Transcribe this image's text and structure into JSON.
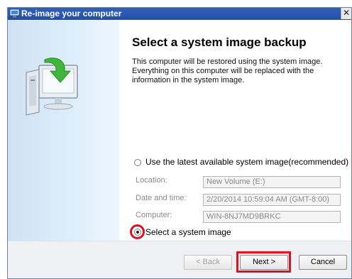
{
  "window": {
    "title": "Re-image your computer",
    "close_glyph": "✕"
  },
  "main": {
    "heading": "Select a system image backup",
    "description": "This computer will be restored using the system image. Everything on this computer will be replaced with the information in the system image."
  },
  "options": {
    "latest_label": "Use the latest available system image(recommended)",
    "select_label": "Select a system image",
    "selected": "select"
  },
  "fields": {
    "location_label": "Location:",
    "location_value": "New Volume (E:)",
    "datetime_label": "Date and time:",
    "datetime_value": "2/20/2014 10:59:04 AM (GMT-8:00)",
    "computer_label": "Computer:",
    "computer_value": "WIN-8NJ7MD9BRKC"
  },
  "buttons": {
    "back": "< Back",
    "next": "Next >",
    "cancel": "Cancel"
  },
  "icons": {
    "title": "restore-icon",
    "art": "computer-restore-icon",
    "close": "close-icon"
  },
  "colors": {
    "titlebar": "#2b58b3",
    "highlight": "#e0101e"
  }
}
